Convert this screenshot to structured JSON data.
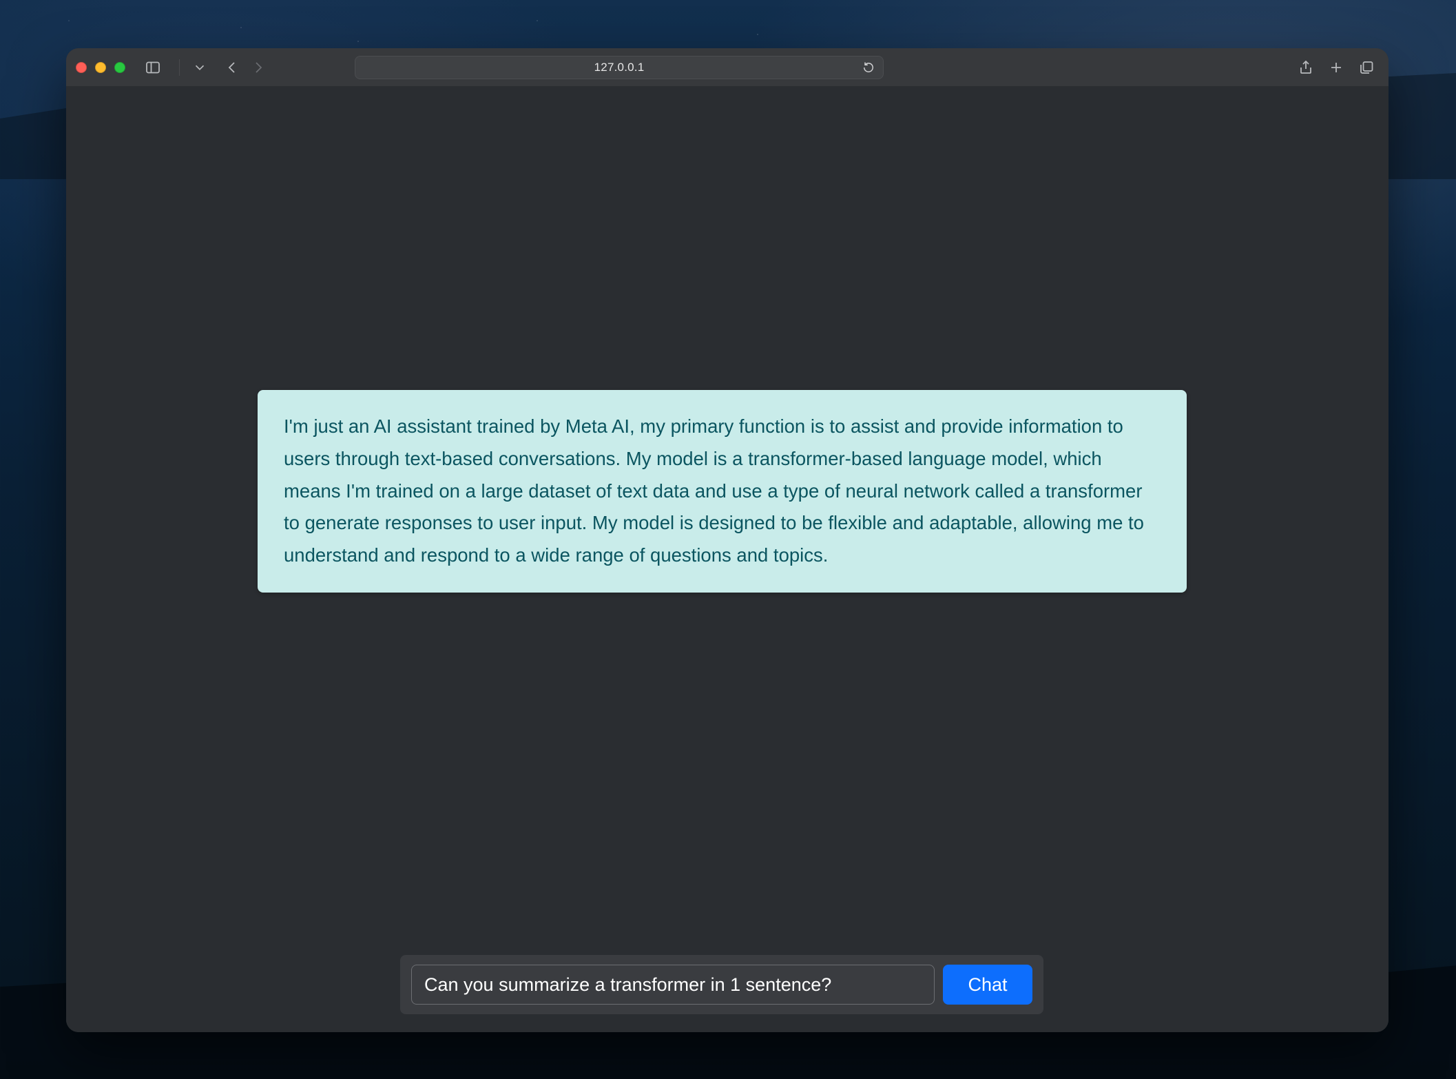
{
  "browser": {
    "address": "127.0.0.1"
  },
  "chat": {
    "assistant_message": "I'm just an AI assistant trained by Meta AI, my primary function is to assist and provide information to users through text-based conversations. My model is a transformer-based language model, which means I'm trained on a large dataset of text data and use a type of neural network called a transformer to generate responses to user input. My model is designed to be flexible and adaptable, allowing me to understand and respond to a wide range of questions and topics.",
    "input_value": "Can you summarize a transformer in 1 sentence?",
    "send_label": "Chat"
  }
}
